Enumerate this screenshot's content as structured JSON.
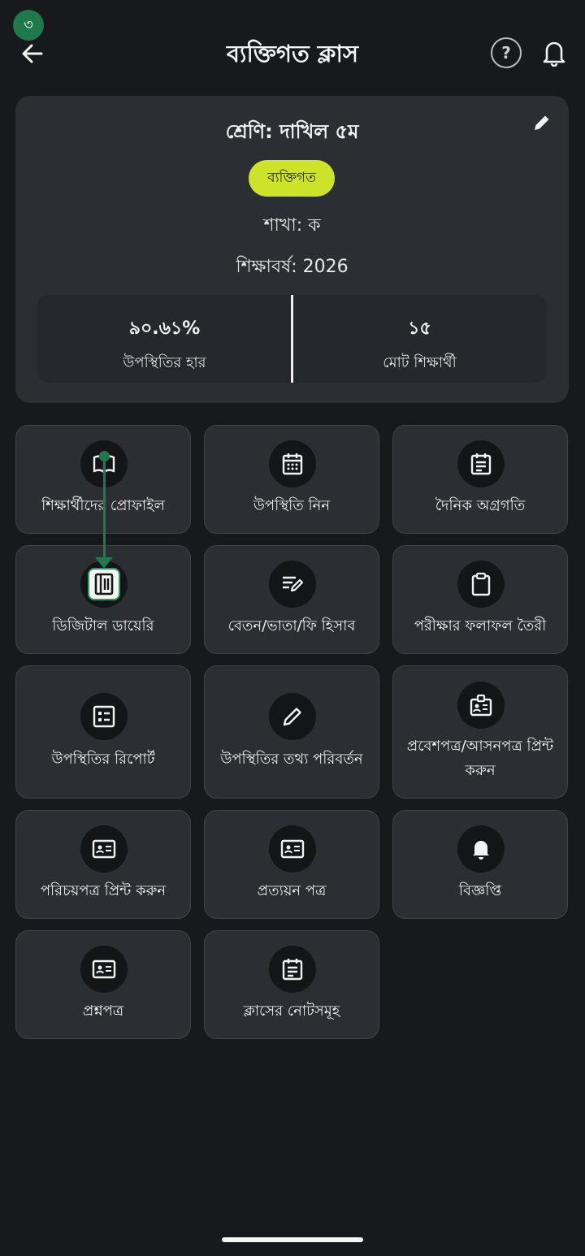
{
  "step_badge": "৩",
  "header": {
    "title": "ব্যক্তিগত ক্লাস",
    "help_label": "?"
  },
  "class_card": {
    "class_name": "শ্রেণি: দাখিল ৫ম",
    "type_chip": "ব্যক্তিগত",
    "section": "শাখা: ক",
    "academic_year": "শিক্ষাবর্ষ: 2026",
    "stats": [
      {
        "value": "৯০.৬১%",
        "label": "উপস্থিতির হার"
      },
      {
        "value": "১৫",
        "label": "মোট শিক্ষার্থী"
      }
    ]
  },
  "tiles": [
    {
      "label": "শিক্ষার্থীদের প্রোফাইল",
      "icon": "book-open-icon"
    },
    {
      "label": "উপস্থিতি নিন",
      "icon": "calendar-icon"
    },
    {
      "label": "দৈনিক অগ্রগতি",
      "icon": "calendar-notes-icon"
    },
    {
      "label": "ডিজিটাল ডায়েরি",
      "icon": "diary-icon"
    },
    {
      "label": "বেতন/ভাতা/ফি হিসাব",
      "icon": "edit-note-icon"
    },
    {
      "label": "পরীক্ষার ফলাফল তৈরী",
      "icon": "clipboard-icon"
    },
    {
      "label": "উপস্থিতির রিপোর্ট",
      "icon": "report-list-icon"
    },
    {
      "label": "উপস্থিতির তথ্য পরিবর্তন",
      "icon": "pencil-icon"
    },
    {
      "label": "প্রবেশপত্র/আসনপত্র প্রিন্ট করুন",
      "icon": "badge-icon"
    },
    {
      "label": "পরিচয়পত্র প্রিন্ট করুন",
      "icon": "id-card-icon"
    },
    {
      "label": "প্রত্যয়ন পত্র",
      "icon": "id-card-icon"
    },
    {
      "label": "বিজ্ঞপ্তি",
      "icon": "bell-icon"
    },
    {
      "label": "প্রশ্নপত্র",
      "icon": "id-card-icon"
    },
    {
      "label": "ক্লাসের নোটসমূহ",
      "icon": "calendar-notes-icon"
    }
  ],
  "colors": {
    "background": "#17191c",
    "card": "#2b2e33",
    "chip": "#cde32a",
    "annotation": "#1e7a4c"
  }
}
